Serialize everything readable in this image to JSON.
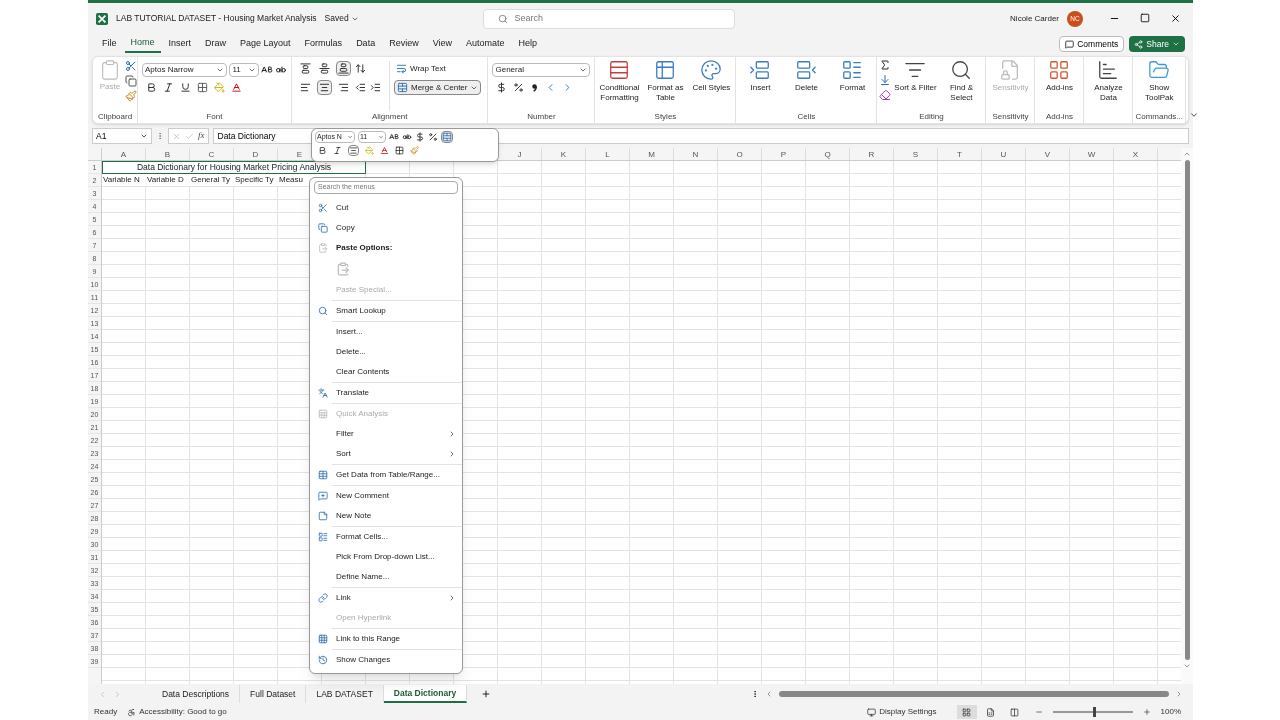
{
  "window": {
    "title": "LAB TUTORIAL DATASET - Housing Market Analysis",
    "save_status": "Saved"
  },
  "search": {
    "placeholder": "Search"
  },
  "user": {
    "name": "Nicole Carder",
    "initials": "NC"
  },
  "menu_tabs": [
    {
      "label": "File",
      "selected": false
    },
    {
      "label": "Home",
      "selected": true
    },
    {
      "label": "Insert",
      "selected": false
    },
    {
      "label": "Draw",
      "selected": false
    },
    {
      "label": "Page Layout",
      "selected": false
    },
    {
      "label": "Formulas",
      "selected": false
    },
    {
      "label": "Data",
      "selected": false
    },
    {
      "label": "Review",
      "selected": false
    },
    {
      "label": "View",
      "selected": false
    },
    {
      "label": "Automate",
      "selected": false
    },
    {
      "label": "Help",
      "selected": false
    }
  ],
  "actions": {
    "comments": "Comments",
    "share": "Share"
  },
  "ribbon": {
    "clipboard": {
      "label": "Clipboard",
      "paste": "Paste",
      "paste_disabled": true
    },
    "font": {
      "label": "Font",
      "name": "Aptos Narrow",
      "size": "11"
    },
    "alignment": {
      "label": "Alignment",
      "wrap_text": "Wrap Text",
      "merge": "Merge & Center",
      "merge_on": true,
      "vertical": [
        {
          "selected": false
        },
        {
          "selected": false
        },
        {
          "selected": true
        }
      ],
      "horizontal": [
        {
          "selected": false
        },
        {
          "selected": true
        },
        {
          "selected": false
        }
      ]
    },
    "number": {
      "label": "Number",
      "format": "General"
    },
    "groups": [
      {
        "kind": "large",
        "label": "Styles",
        "buttons": [
          {
            "label": "Conditional Formatting",
            "disabled": false
          },
          {
            "label": "Format as Table",
            "disabled": false
          },
          {
            "label": "Cell Styles",
            "disabled": false
          }
        ]
      },
      {
        "kind": "large",
        "label": "Cells",
        "buttons": [
          {
            "label": "Insert",
            "disabled": false
          },
          {
            "label": "Delete",
            "disabled": false
          },
          {
            "label": "Format",
            "disabled": false
          }
        ]
      },
      {
        "kind": "editing",
        "label": "Editing",
        "buttons": [
          {
            "label": "Sort & Filter",
            "disabled": false
          },
          {
            "label": "Find & Select",
            "disabled": false
          }
        ]
      },
      {
        "kind": "large",
        "label": "Sensitivity",
        "buttons": [
          {
            "label": "Sensitivity",
            "disabled": true
          }
        ]
      },
      {
        "kind": "large",
        "label": "Add-ins",
        "buttons": [
          {
            "label": "Add-ins",
            "disabled": false
          }
        ]
      },
      {
        "kind": "large",
        "buttons": [
          {
            "label": "Analyze Data",
            "disabled": false
          }
        ]
      },
      {
        "kind": "large",
        "label": "Commands...",
        "buttons": [
          {
            "label": "Show ToolPak",
            "disabled": false
          }
        ]
      }
    ]
  },
  "formula_bar": {
    "name_box": "A1",
    "function_label": "fx",
    "content": "Data Dictionary"
  },
  "sheet": {
    "columns_left": [
      "A",
      "B",
      "C",
      "D",
      "E"
    ],
    "columns_right": [
      "J",
      "K",
      "L",
      "M",
      "N",
      "O",
      "P",
      "Q",
      "R",
      "S",
      "T",
      "U",
      "V",
      "W",
      "X"
    ],
    "rows": [
      "1",
      "2",
      "3",
      "4",
      "5",
      "6",
      "7",
      "8",
      "9",
      "10",
      "11",
      "12",
      "13",
      "14",
      "15",
      "16",
      "17",
      "18",
      "19",
      "20",
      "21",
      "22",
      "23",
      "24",
      "25",
      "26",
      "27",
      "28",
      "29",
      "30",
      "31",
      "32",
      "33",
      "34",
      "35",
      "36",
      "37",
      "38",
      "39"
    ],
    "title": "Data Dictionary for Housing Market Pricing Analysis",
    "row2": [
      "Variable N",
      "Variable D",
      "General Ty",
      "Specific Ty",
      "Measu"
    ]
  },
  "mini_toolbar": {
    "font": "Aptos N",
    "size": "11"
  },
  "context_menu": {
    "search_placeholder": "Search the menus",
    "groups": [
      [
        {
          "kind": "item",
          "label": "Cut",
          "disabled": false,
          "submenu": false
        },
        {
          "kind": "item",
          "label": "Copy",
          "disabled": false,
          "submenu": false
        },
        {
          "kind": "header",
          "label": "Paste Options:"
        },
        {
          "kind": "paste-slot"
        },
        {
          "kind": "item",
          "label": "Paste Special...",
          "disabled": true,
          "submenu": false
        }
      ],
      [
        {
          "kind": "item",
          "label": "Smart Lookup",
          "disabled": false,
          "submenu": false
        }
      ],
      [
        {
          "kind": "item",
          "label": "Insert...",
          "disabled": false,
          "submenu": false
        },
        {
          "kind": "item",
          "label": "Delete...",
          "disabled": false,
          "submenu": false
        },
        {
          "kind": "item",
          "label": "Clear Contents",
          "disabled": false,
          "submenu": false
        }
      ],
      [
        {
          "kind": "item",
          "label": "Translate",
          "disabled": false,
          "submenu": false
        }
      ],
      [
        {
          "kind": "item",
          "label": "Quick Analysis",
          "disabled": true,
          "submenu": false
        },
        {
          "kind": "item",
          "label": "Filter",
          "disabled": false,
          "submenu": true
        },
        {
          "kind": "item",
          "label": "Sort",
          "disabled": false,
          "submenu": true
        }
      ],
      [
        {
          "kind": "item",
          "label": "Get Data from Table/Range...",
          "disabled": false,
          "submenu": false
        }
      ],
      [
        {
          "kind": "item",
          "label": "New Comment",
          "disabled": false,
          "submenu": false
        },
        {
          "kind": "item",
          "label": "New Note",
          "disabled": false,
          "submenu": false
        }
      ],
      [
        {
          "kind": "item",
          "label": "Format Cells...",
          "disabled": false,
          "submenu": false
        },
        {
          "kind": "item",
          "label": "Pick From Drop-down List...",
          "disabled": false,
          "submenu": false
        },
        {
          "kind": "item",
          "label": "Define Name...",
          "disabled": false,
          "submenu": false
        }
      ],
      [
        {
          "kind": "item",
          "label": "Link",
          "disabled": false,
          "submenu": true
        },
        {
          "kind": "item",
          "label": "Open Hyperlink",
          "disabled": true,
          "submenu": false
        }
      ],
      [
        {
          "kind": "item",
          "label": "Link to this Range",
          "disabled": false,
          "submenu": false
        }
      ],
      [
        {
          "kind": "item",
          "label": "Show Changes",
          "disabled": false,
          "submenu": false
        }
      ]
    ]
  },
  "sheet_tabs": [
    {
      "label": "Data Descriptions",
      "selected": false
    },
    {
      "label": "Full Dataset",
      "selected": false
    },
    {
      "label": "LAB DATASET",
      "selected": false
    },
    {
      "label": "Data Dictionary",
      "selected": true
    }
  ],
  "status_bar": {
    "ready": "Ready",
    "accessibility": "Accessibility: Good to go",
    "display_settings": "Display Settings",
    "views": [
      {
        "selected": true
      },
      {
        "selected": false
      },
      {
        "selected": false
      }
    ],
    "zoom": {
      "level": 0.5,
      "text": "100%"
    }
  }
}
